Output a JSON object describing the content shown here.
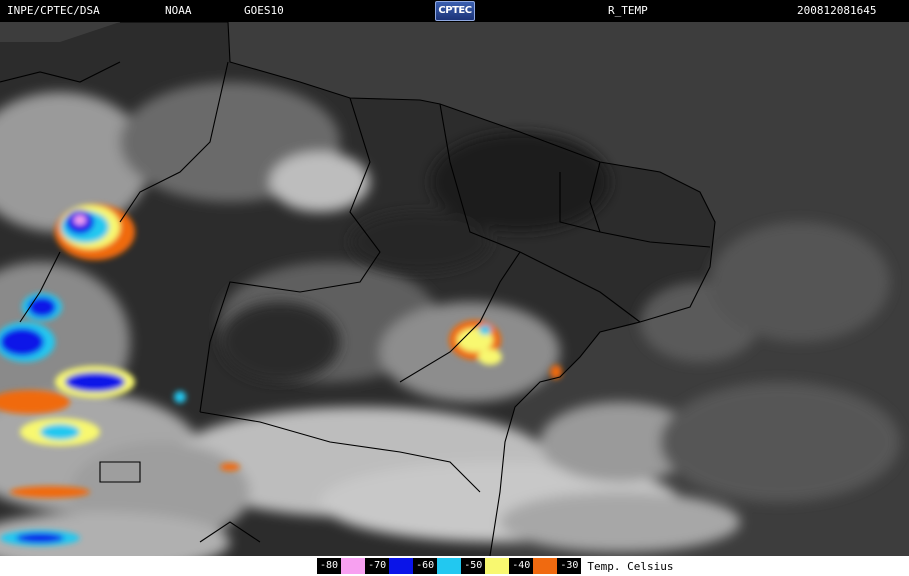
{
  "header": {
    "institution": "INPE/CPTEC/DSA",
    "agency": "NOAA",
    "satellite": "GOES10",
    "logo_text": "CPTEC",
    "product": "R_TEMP",
    "timestamp": "200812081645"
  },
  "legend": {
    "title": "Temp. Celsius",
    "items": [
      {
        "label": "-80",
        "color": "#f7a0f0"
      },
      {
        "label": "-70",
        "color": "#0a14e8"
      },
      {
        "label": "-60",
        "color": "#22c8f0"
      },
      {
        "label": "-50",
        "color": "#f8f870"
      },
      {
        "label": "-40",
        "color": "#f06a10"
      },
      {
        "label": "-30",
        "color": null
      }
    ]
  },
  "colors": {
    "background": "#000000",
    "land_clear": "#2e2e2e",
    "ocean": "#3f3f3f",
    "cloud": "#b5b5b5",
    "borders": "#000000"
  }
}
